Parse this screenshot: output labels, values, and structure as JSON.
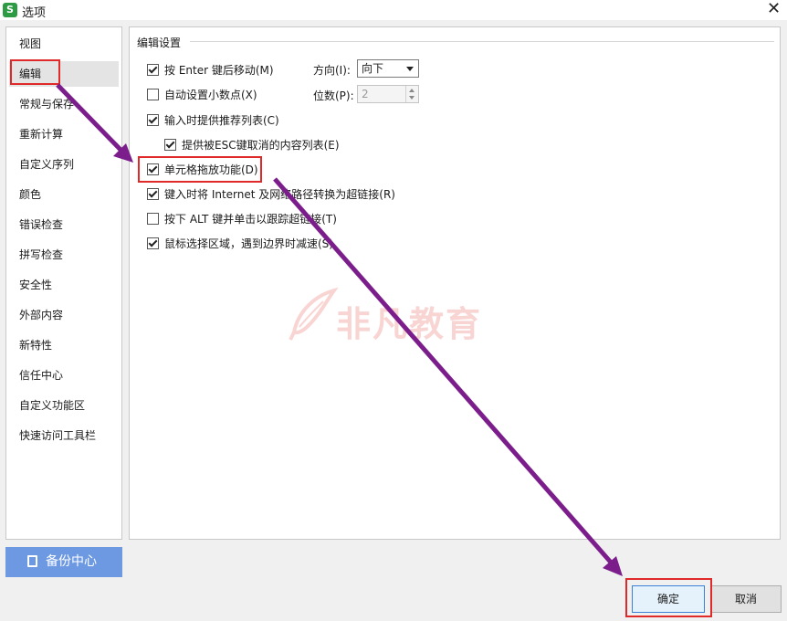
{
  "window": {
    "title": "选项",
    "app_icon_letter": "S"
  },
  "sidebar": {
    "items": [
      {
        "label": "视图"
      },
      {
        "label": "编辑"
      },
      {
        "label": "常规与保存"
      },
      {
        "label": "重新计算"
      },
      {
        "label": "自定义序列"
      },
      {
        "label": "颜色"
      },
      {
        "label": "错误检查"
      },
      {
        "label": "拼写检查"
      },
      {
        "label": "安全性"
      },
      {
        "label": "外部内容"
      },
      {
        "label": "新特性"
      },
      {
        "label": "信任中心"
      },
      {
        "label": "自定义功能区"
      },
      {
        "label": "快速访问工具栏"
      }
    ],
    "active_index": 1,
    "backup_label": "备份中心"
  },
  "edit": {
    "section_title": "编辑设置",
    "options": [
      {
        "label": "按 Enter 键后移动(M)",
        "checked": true
      },
      {
        "label": "自动设置小数点(X)",
        "checked": false
      },
      {
        "label": "输入时提供推荐列表(C)",
        "checked": true
      },
      {
        "label": "提供被ESC键取消的内容列表(E)",
        "checked": true
      },
      {
        "label": "单元格拖放功能(D)",
        "checked": true
      },
      {
        "label": "键入时将 Internet 及网络路径转换为超链接(R)",
        "checked": true
      },
      {
        "label": "按下 ALT 键并单击以跟踪超链接(T)",
        "checked": false
      },
      {
        "label": "鼠标选择区域，遇到边界时减速(S)",
        "checked": true
      }
    ],
    "direction_label": "方向(I):",
    "direction_value": "向下",
    "places_label": "位数(P):",
    "places_value": "2"
  },
  "watermark": {
    "text": "非凡教育"
  },
  "footer": {
    "ok_label": "确定",
    "cancel_label": "取消"
  },
  "colors": {
    "highlight": "#e02a2a",
    "arrow": "#7b1e8c",
    "accent": "#6d99e3"
  }
}
